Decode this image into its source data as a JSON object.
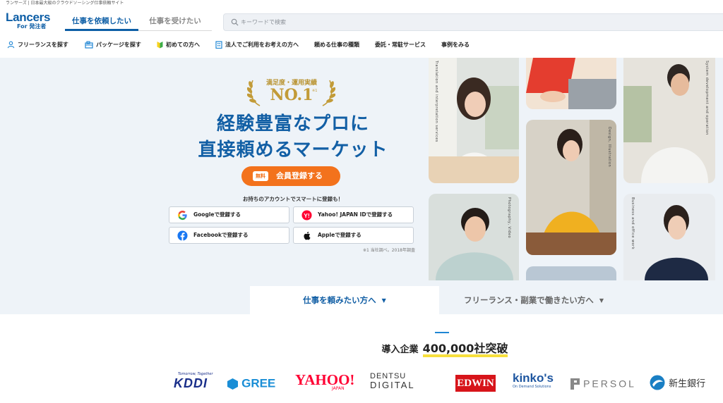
{
  "header": {
    "tagline": "ランサーズ | 日本最大級のクラウドソーシング仕事依頼サイト",
    "logo_main": "Lancers",
    "logo_sub": "For 発注者",
    "tab_active": "仕事を依頼したい",
    "tab_inactive": "仕事を受けたい",
    "search_placeholder": "キーワードで検索"
  },
  "nav": {
    "items": [
      {
        "label": "フリーランスを探す",
        "icon": "person-icon"
      },
      {
        "label": "パッケージを探す",
        "icon": "package-icon"
      },
      {
        "label": "初めての方へ",
        "icon": "beginner-mark-icon"
      },
      {
        "label": "法人でご利用をお考えの方へ",
        "icon": "building-icon"
      },
      {
        "label": "頼める仕事の種類",
        "icon": ""
      },
      {
        "label": "委託・常駐サービス",
        "icon": ""
      },
      {
        "label": "事例をみる",
        "icon": ""
      }
    ]
  },
  "hero": {
    "award_label": "満足度・運用実績",
    "award_rank": "NO.1",
    "award_note": "※1",
    "headline_line1": "経験豊富なプロに",
    "headline_line2": "直接頼めるマーケット",
    "cta_badge": "無料",
    "cta_label": "会員登録する",
    "social_prompt": "お持ちのアカウントでスマートに登録も！",
    "social_buttons": [
      {
        "label": "Googleで登録する",
        "icon": "google-icon"
      },
      {
        "label": "Yahoo! JAPAN IDで登録する",
        "icon": "yahoo-icon"
      },
      {
        "label": "Facebookで登録する",
        "icon": "facebook-icon"
      },
      {
        "label": "Appleで登録する",
        "icon": "apple-icon"
      }
    ],
    "survey_note": "※1 当社調べ。2018年調査",
    "photo_captions": [
      "Translation and interpretation services",
      "Design, Illustration",
      "System development and operation",
      "Photography, Video",
      "Business and office work"
    ]
  },
  "segments": {
    "active": "仕事を頼みたい方へ",
    "inactive": "フリーランス・副業で働きたい方へ"
  },
  "companies": {
    "title_prefix": "導入企業",
    "title_count": "400,000社突破",
    "logos": [
      {
        "name": "KDDI",
        "tagline": "Tomorrow, Together"
      },
      {
        "name": "GREE"
      },
      {
        "name": "YAHOO!",
        "sub": "JAPAN"
      },
      {
        "name": "DENTSU",
        "sub": "DIGITAL"
      },
      {
        "name": "EDWIN"
      },
      {
        "name": "kinko's",
        "sub": "On Demand Solutions"
      },
      {
        "name": "PERSOL"
      },
      {
        "name": "新生銀行"
      }
    ]
  },
  "colors": {
    "brand_blue": "#0d5ea6",
    "cta_orange": "#f3721c",
    "hero_bg": "#eef3f8",
    "gold": "#c29b38"
  }
}
